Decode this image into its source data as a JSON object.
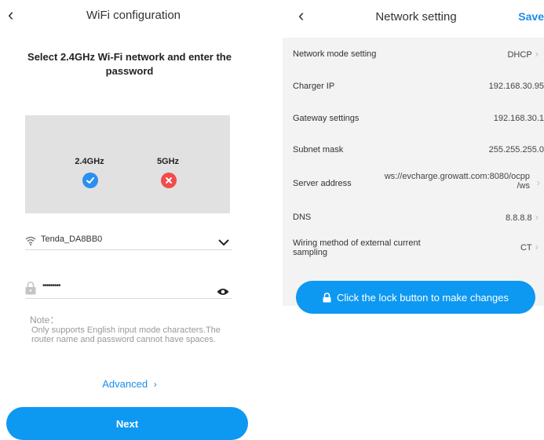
{
  "left": {
    "back_icon": "chevron-left-icon",
    "title": "WiFi configuration",
    "heading": "Select 2.4GHz Wi-Fi network and enter the password",
    "band_24": "2.4GHz",
    "band_5": "5GHz",
    "ssid": "Tenda_DA8BB0",
    "password_masked": "•••••••••",
    "note_title": "Note：",
    "note_body": "Only supports English input mode characters.The router name and password cannot have spaces.",
    "advanced": "Advanced",
    "next": "Next",
    "colors": {
      "accent": "#0d98f2",
      "ok": "#2a8ff0",
      "error": "#f24b4b"
    }
  },
  "right": {
    "title": "Network setting",
    "save": "Save",
    "rows": [
      {
        "label": "Network mode setting",
        "value": "DHCP",
        "chevron": true
      },
      {
        "label": "Charger IP",
        "value": "192.168.30.95",
        "chevron": false
      },
      {
        "label": "Gateway settings",
        "value": "192.168.30.1",
        "chevron": false
      },
      {
        "label": "Subnet mask",
        "value": "255.255.255.0",
        "chevron": false
      },
      {
        "label": "Server address",
        "value_line1": "ws://evcharge.growatt.com:8080/ocpp",
        "value_line2": "/ws",
        "chevron": true
      },
      {
        "label": "DNS",
        "value": "8.8.8.8",
        "chevron": true
      },
      {
        "label_line1": "Wiring method of external current",
        "label_line2": "sampling",
        "value": "CT",
        "chevron": true
      }
    ],
    "lock_button": "Click the lock button to make changes"
  }
}
